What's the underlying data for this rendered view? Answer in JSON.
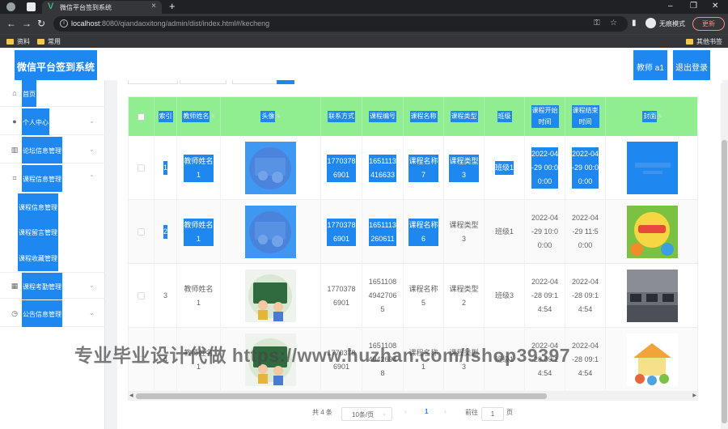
{
  "browser": {
    "tab_title": "微信平台签到系统",
    "url_host": "localhost",
    "url_rest": ":8080/qiandaoxitong/admin/dist/index.html#/kecheng",
    "incognito_label": "无痕模式",
    "update_label": "更新",
    "bookmarks": [
      "资料",
      "常用"
    ],
    "other_bookmarks": "其他书签"
  },
  "app": {
    "title": "微信平台签到系统",
    "user_label": "教师 a1",
    "logout_label": "退出登录"
  },
  "sidebar": {
    "items": [
      {
        "label": "首页",
        "icon": "home-icon"
      },
      {
        "label": "个人中心",
        "icon": "user-icon"
      },
      {
        "label": "论坛信息管理",
        "icon": "forum-icon"
      },
      {
        "label": "课程信息管理",
        "icon": "course-icon"
      },
      {
        "label": "课程考勤管理",
        "icon": "grid-icon"
      },
      {
        "label": "公告信息管理",
        "icon": "notice-icon"
      }
    ],
    "submenu": [
      "课程信息管理",
      "课程留言管理",
      "课程收藏管理"
    ]
  },
  "table": {
    "columns": [
      "索引",
      "教师姓名",
      "头像",
      "联系方式",
      "课程编号",
      "课程名称",
      "课程类型",
      "班级",
      "课程开始\n时间",
      "课程结束\n时间",
      "封面"
    ],
    "rows": [
      {
        "index": "1",
        "teacher": "教师姓名\n1",
        "phone": "1770378\n6901",
        "code": "1651113\n416633",
        "name": "课程名称\n7",
        "type": "课程类型\n3",
        "cls": "班级1",
        "start": "2022-04\n-29 00:0\n0:00",
        "end": "2022-04\n-29 00:0\n0:00"
      },
      {
        "index": "2",
        "teacher": "教师姓名\n1",
        "phone": "1770378\n6901",
        "code": "1651113\n260611",
        "name": "课程名称\n6",
        "type": "课程类型\n3",
        "cls": "班级1",
        "start": "2022-04\n-29 10:0\n0:00",
        "end": "2022-04\n-29 11:5\n0:00"
      },
      {
        "index": "3",
        "teacher": "教师姓名\n1",
        "phone": "1770378\n6901",
        "code": "1651108\n4942706\n5",
        "name": "课程名称\n5",
        "type": "课程类型\n2",
        "cls": "班级3",
        "start": "2022-04\n-28 09:1\n4:54",
        "end": "2022-04\n-28 09:1\n4:54"
      },
      {
        "index": "4",
        "teacher": "教师姓名\n1",
        "phone": "1770378\n6901",
        "code": "1651108\n4942694\n8",
        "name": "课程名称\n1",
        "type": "课程类型\n3",
        "cls": "班级1",
        "start": "2022-04\n-28 09:1\n4:54",
        "end": "2022-04\n-28 09:1\n4:54"
      }
    ]
  },
  "pagination": {
    "total": "共 4 条",
    "page_size": "10条/页",
    "current_page": "1",
    "goto_label": "前往",
    "goto_value": "1",
    "page_suffix": "页"
  },
  "watermark": "专业毕业设计代做  https://www.huzhan.com/ishop39397"
}
